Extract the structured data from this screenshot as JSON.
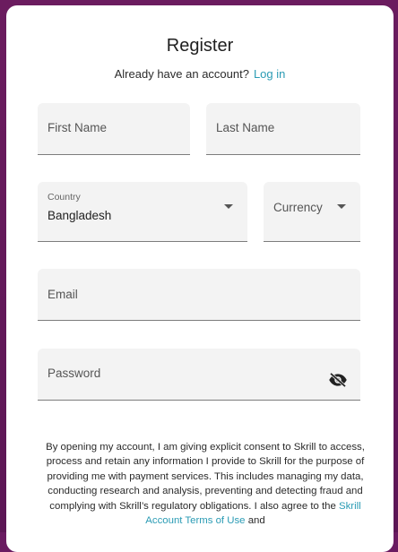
{
  "header": {
    "title": "Register",
    "login_prompt": "Already have an account?",
    "login_link": "Log in"
  },
  "form": {
    "first_name_label": "First Name",
    "last_name_label": "Last Name",
    "country_label": "Country",
    "country_value": "Bangladesh",
    "currency_label": "Currency",
    "email_label": "Email",
    "password_label": "Password"
  },
  "icons": {
    "country_dropdown": "chevron-down-icon",
    "currency_dropdown": "chevron-down-icon",
    "password_visibility": "eye-off-icon"
  },
  "consent": {
    "text_before_link": "By opening my account, I am giving explicit consent to Skrill to access, process and retain any information I provide to Skrill for the purpose of providing me with payment services. This includes managing my data, conducting research and analysis, preventing and detecting fraud and complying with Skrill’s regulatory obligations. I also agree to the",
    "terms_link": "Skrill Account Terms of Use",
    "text_after_link": "and"
  },
  "colors": {
    "background": "#6a1b61",
    "link": "#2a9bb4",
    "field_bg": "#f3f3f3"
  }
}
